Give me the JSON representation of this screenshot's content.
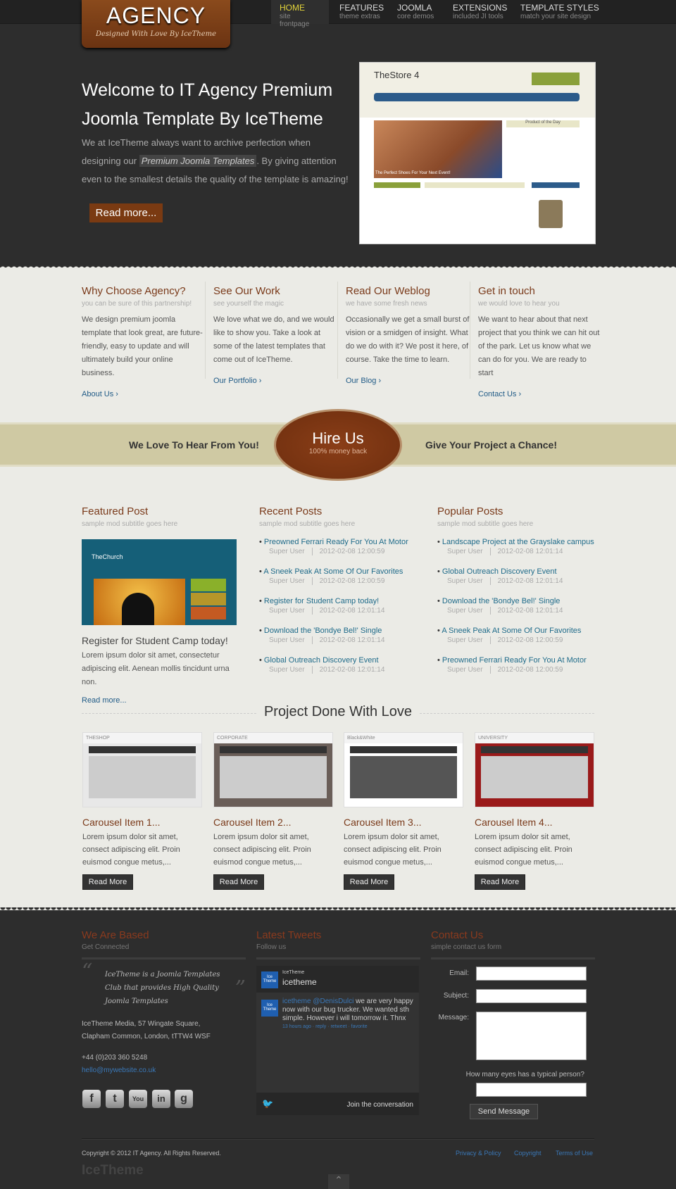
{
  "logo": {
    "title": "AGENCY",
    "tagline": "Designed With Love By IceTheme"
  },
  "nav": [
    {
      "label": "HOME",
      "desc": "site frontpage"
    },
    {
      "label": "FEATURES",
      "desc": "theme extras"
    },
    {
      "label": "JOOMLA",
      "desc": "core demos"
    },
    {
      "label": "EXTENSIONS",
      "desc": "included JI tools"
    },
    {
      "label": "TEMPLATE STYLES",
      "desc": "match your site design"
    }
  ],
  "hero": {
    "title": "Welcome to IT Agency Premium Joomla Template By IceTheme",
    "text_before": "We at IceTheme always want to archive perfection when designing our",
    "highlight": "Premium Joomla Templates",
    "text_after": ". By giving attention even to the smallest details the quality of the template is amazing!",
    "button": "Read more...",
    "shot_title": "TheStore 4",
    "shot_caption": "The Perfect Shoes For Your Next Event!",
    "shot_box": "Product of the Day"
  },
  "features": [
    {
      "title": "Why Choose Agency?",
      "subtitle": "you can be sure of this partnership!",
      "text": "We design premium joomla template that look great, are future-friendly, easy to update and will ultimately build your online business.",
      "link": "About Us ›"
    },
    {
      "title": "See Our Work",
      "subtitle": "see yourself the magic",
      "text": "We love what we do, and we would like to show you. Take a look at some of the latest templates that come out of IceTheme.",
      "link": "Our Portfolio ›"
    },
    {
      "title": "Read Our Weblog",
      "subtitle": "we have some fresh news",
      "text": "Occasionally we get a small burst of vision or a smidgen of insight. What do we do with it? We post it here, of course. Take the time to learn.",
      "link": "Our Blog ›"
    },
    {
      "title": "Get in touch",
      "subtitle": "we would love to hear you",
      "text": "We want to hear about that next project that you think we can hit out of the park. Let us know what we can do for you. We are ready to start",
      "link": "Contact Us ›"
    }
  ],
  "hire": {
    "left": "We Love To Hear From You!",
    "title": "Hire Us",
    "subtitle": "100% money back",
    "right": "Give Your Project a Chance!"
  },
  "featured": {
    "title": "Featured Post",
    "subtitle": "sample mod subtitle goes here",
    "shot_title": "TheChurch",
    "post_title": "Register for Student Camp today!",
    "text": "Lorem ipsum dolor sit amet, consectetur adipiscing elit. Aenean mollis tincidunt urna non.",
    "link": "Read more..."
  },
  "recent": {
    "title": "Recent Posts",
    "subtitle": "sample mod subtitle goes here",
    "items": [
      {
        "title": "Preowned Ferrari Ready For You At Motor",
        "author": "Super User",
        "date": "2012-02-08 12:00:59"
      },
      {
        "title": "A Sneek Peak At Some Of Our Favorites",
        "author": "Super User",
        "date": "2012-02-08 12:00:59"
      },
      {
        "title": "Register for Student Camp today!",
        "author": "Super User",
        "date": "2012-02-08 12:01:14"
      },
      {
        "title": "Download the 'Bondye Bel!' Single",
        "author": "Super User",
        "date": "2012-02-08 12:01:14"
      },
      {
        "title": "Global Outreach Discovery Event",
        "author": "Super User",
        "date": "2012-02-08 12:01:14"
      }
    ]
  },
  "popular": {
    "title": "Popular Posts",
    "subtitle": "sample mod subtitle goes here",
    "items": [
      {
        "title": "Landscape Project at the Grayslake campus",
        "author": "Super User",
        "date": "2012-02-08 12:01:14"
      },
      {
        "title": "Global Outreach Discovery Event",
        "author": "Super User",
        "date": "2012-02-08 12:01:14"
      },
      {
        "title": "Download the 'Bondye Bel!' Single",
        "author": "Super User",
        "date": "2012-02-08 12:01:14"
      },
      {
        "title": "A Sneek Peak At Some Of Our Favorites",
        "author": "Super User",
        "date": "2012-02-08 12:00:59"
      },
      {
        "title": "Preowned Ferrari Ready For You At Motor",
        "author": "Super User",
        "date": "2012-02-08 12:00:59"
      }
    ]
  },
  "projects": {
    "title": "Project Done With Love",
    "items": [
      {
        "title": "Carousel Item 1...",
        "text": "Lorem ipsum dolor sit amet, consect adipiscing elit. Proin euismod congue metus,...",
        "button": "Read More",
        "shot": "THESHOP"
      },
      {
        "title": "Carousel Item 2...",
        "text": "Lorem ipsum dolor sit amet, consect adipiscing elit. Proin euismod congue metus,...",
        "button": "Read More",
        "shot": "CORPORATE"
      },
      {
        "title": "Carousel Item 3...",
        "text": "Lorem ipsum dolor sit amet, consect adipiscing elit. Proin euismod congue metus,...",
        "button": "Read More",
        "shot": "Black&White"
      },
      {
        "title": "Carousel Item 4...",
        "text": "Lorem ipsum dolor sit amet, consect adipiscing elit. Proin euismod congue metus,...",
        "button": "Read More",
        "shot": "UNIVERSITY"
      }
    ]
  },
  "footer": {
    "based": {
      "title": "We Are Based",
      "subtitle": "Get Connected",
      "quote": "IceTheme is a Joomla Templates Club that provides High Quality Joomla Templates",
      "address1": "IceTheme Media, 57 Wingate Square,",
      "address2": "Clapham Common, London, tTTW4 WSF",
      "phone": "+44 (0)203 360 5248",
      "email": "hello@mywebsite.co.uk",
      "social": [
        "facebook",
        "twitter",
        "youtube",
        "linkedin",
        "google"
      ]
    },
    "tweets": {
      "title": "Latest Tweets",
      "subtitle": "Follow us",
      "name_small": "IceTheme",
      "name": "icetheme",
      "avatar": "Ice Theme",
      "tweet_user": "icetheme @DenisDulci",
      "tweet_text": " we are very happy now with our bug trucker. We wanted sth simple. However i will tomorrow it. Thnx",
      "tweet_meta": "13 hours ago · reply · retweet · favorite",
      "join": "Join the conversation"
    },
    "contact": {
      "title": "Contact Us",
      "subtitle": "simple contact us form",
      "email_label": "Email:",
      "subject_label": "Subject:",
      "message_label": "Message:",
      "question": "How many eyes has a typical person?",
      "button": "Send Message"
    },
    "copyright": "Copyright © 2012 IT Agency. All Rights Reserved.",
    "links": [
      "Privacy & Policy",
      "Copyright",
      "Terms of Use"
    ],
    "brand": "IceTheme"
  }
}
